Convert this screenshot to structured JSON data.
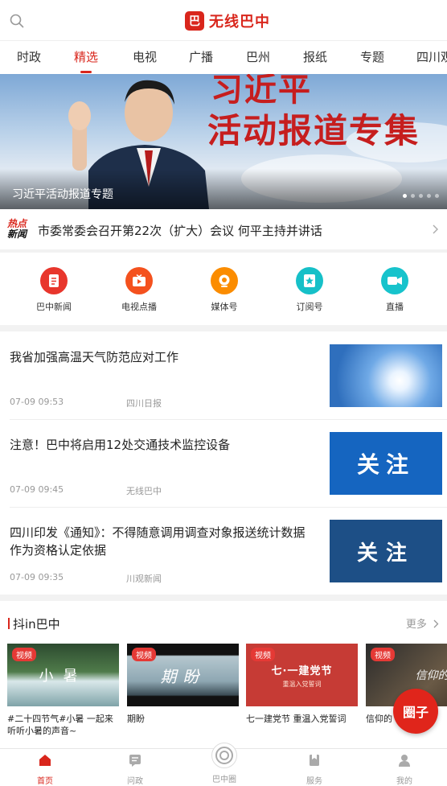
{
  "header": {
    "logo_mark": "巴",
    "app_title": "无线巴中"
  },
  "tabs": [
    {
      "label": "时政"
    },
    {
      "label": "精选",
      "active": true
    },
    {
      "label": "电视"
    },
    {
      "label": "广播"
    },
    {
      "label": "巴州"
    },
    {
      "label": "报纸"
    },
    {
      "label": "专题"
    },
    {
      "label": "四川观"
    }
  ],
  "banner": {
    "title_line1": "习近平",
    "title_line2": "活动报道专集",
    "caption": "习近平活动报道专题",
    "dot_count": 5,
    "active_dot": 1
  },
  "hot": {
    "badge_line1": "热点",
    "badge_line2": "新闻",
    "headline": "市委常委会召开第22次（扩大）会议 何平主持并讲话"
  },
  "quick": [
    {
      "label": "巴中新闻",
      "icon": "document-icon",
      "color": "#e8362c"
    },
    {
      "label": "电视点播",
      "icon": "tv-icon",
      "color": "#f4511e"
    },
    {
      "label": "媒体号",
      "icon": "camera-icon",
      "color": "#fb8c00"
    },
    {
      "label": "订阅号",
      "icon": "bookmark-icon",
      "color": "#16c0c8"
    },
    {
      "label": "直播",
      "icon": "video-icon",
      "color": "#17c3cc"
    }
  ],
  "news": [
    {
      "title": "我省加强高温天气防范应对工作",
      "time": "07-09 09:53",
      "source": "四川日报",
      "thumb": "sky"
    },
    {
      "title": "注意！巴中将启用12处交通技术监控设备",
      "time": "07-09 09:45",
      "source": "无线巴中",
      "thumb": "blue",
      "thumb_text": "关注"
    },
    {
      "title": "四川印发《通知》：不得随意调用调查对象报送统计数据作为资格认定依据",
      "time": "07-09 09:35",
      "source": "川观新闻",
      "thumb": "navy",
      "thumb_text": "关注"
    }
  ],
  "video_section": {
    "title": "抖in巴中",
    "more": "更多",
    "items": [
      {
        "tag": "视频",
        "caption": "#二十四节气#小暑 一起来听听小暑的声音~",
        "art_text": "小暑"
      },
      {
        "tag": "视频",
        "caption": "期盼",
        "art_text": "期盼"
      },
      {
        "tag": "视频",
        "caption": "七一建党节 重温入党誓词",
        "art_text": "七·一建党节",
        "art_sub": "重温入党誓词"
      },
      {
        "tag": "视频",
        "caption": "信仰的",
        "art_text": "信仰的力"
      }
    ]
  },
  "floating": {
    "label": "圈子"
  },
  "tabbar": [
    {
      "label": "首页",
      "icon": "home-icon",
      "active": true
    },
    {
      "label": "问政",
      "icon": "message-icon"
    },
    {
      "label": "巴中圈",
      "icon": "circle-icon"
    },
    {
      "label": "服务",
      "icon": "service-icon"
    },
    {
      "label": "我的",
      "icon": "user-icon"
    }
  ],
  "colors": {
    "brand": "#d9261c",
    "muted": "#999999"
  }
}
